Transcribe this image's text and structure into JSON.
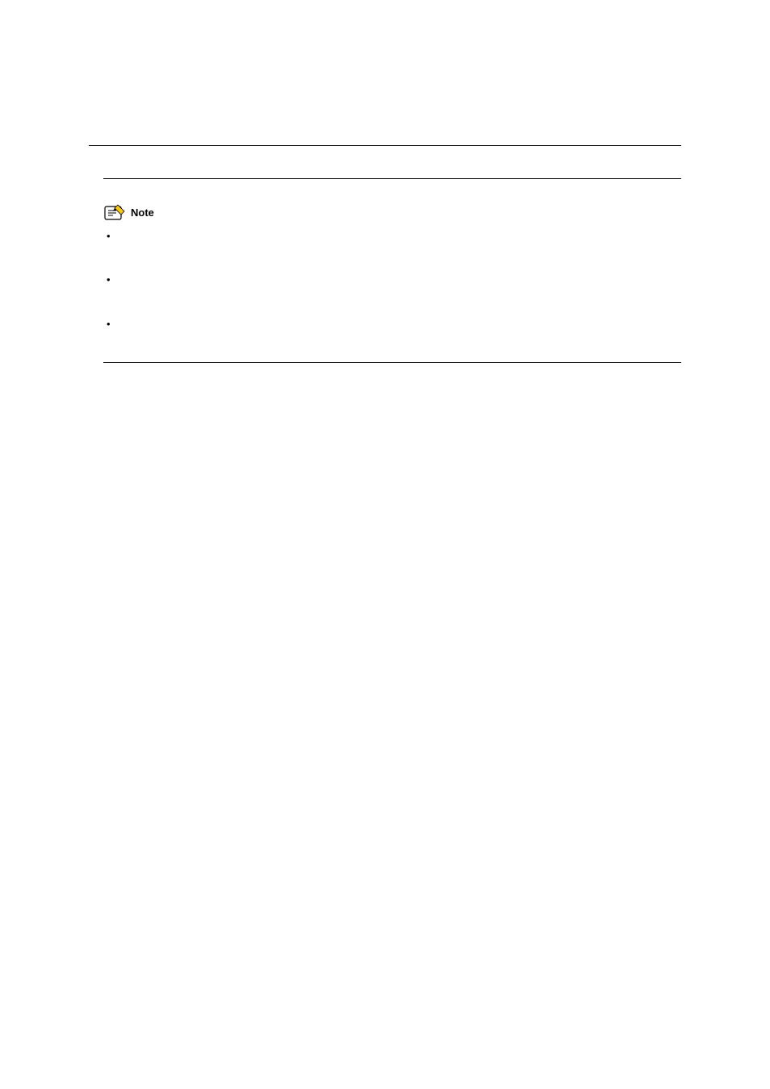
{
  "note": {
    "label": "Note",
    "bullets": [
      "",
      "",
      ""
    ]
  }
}
